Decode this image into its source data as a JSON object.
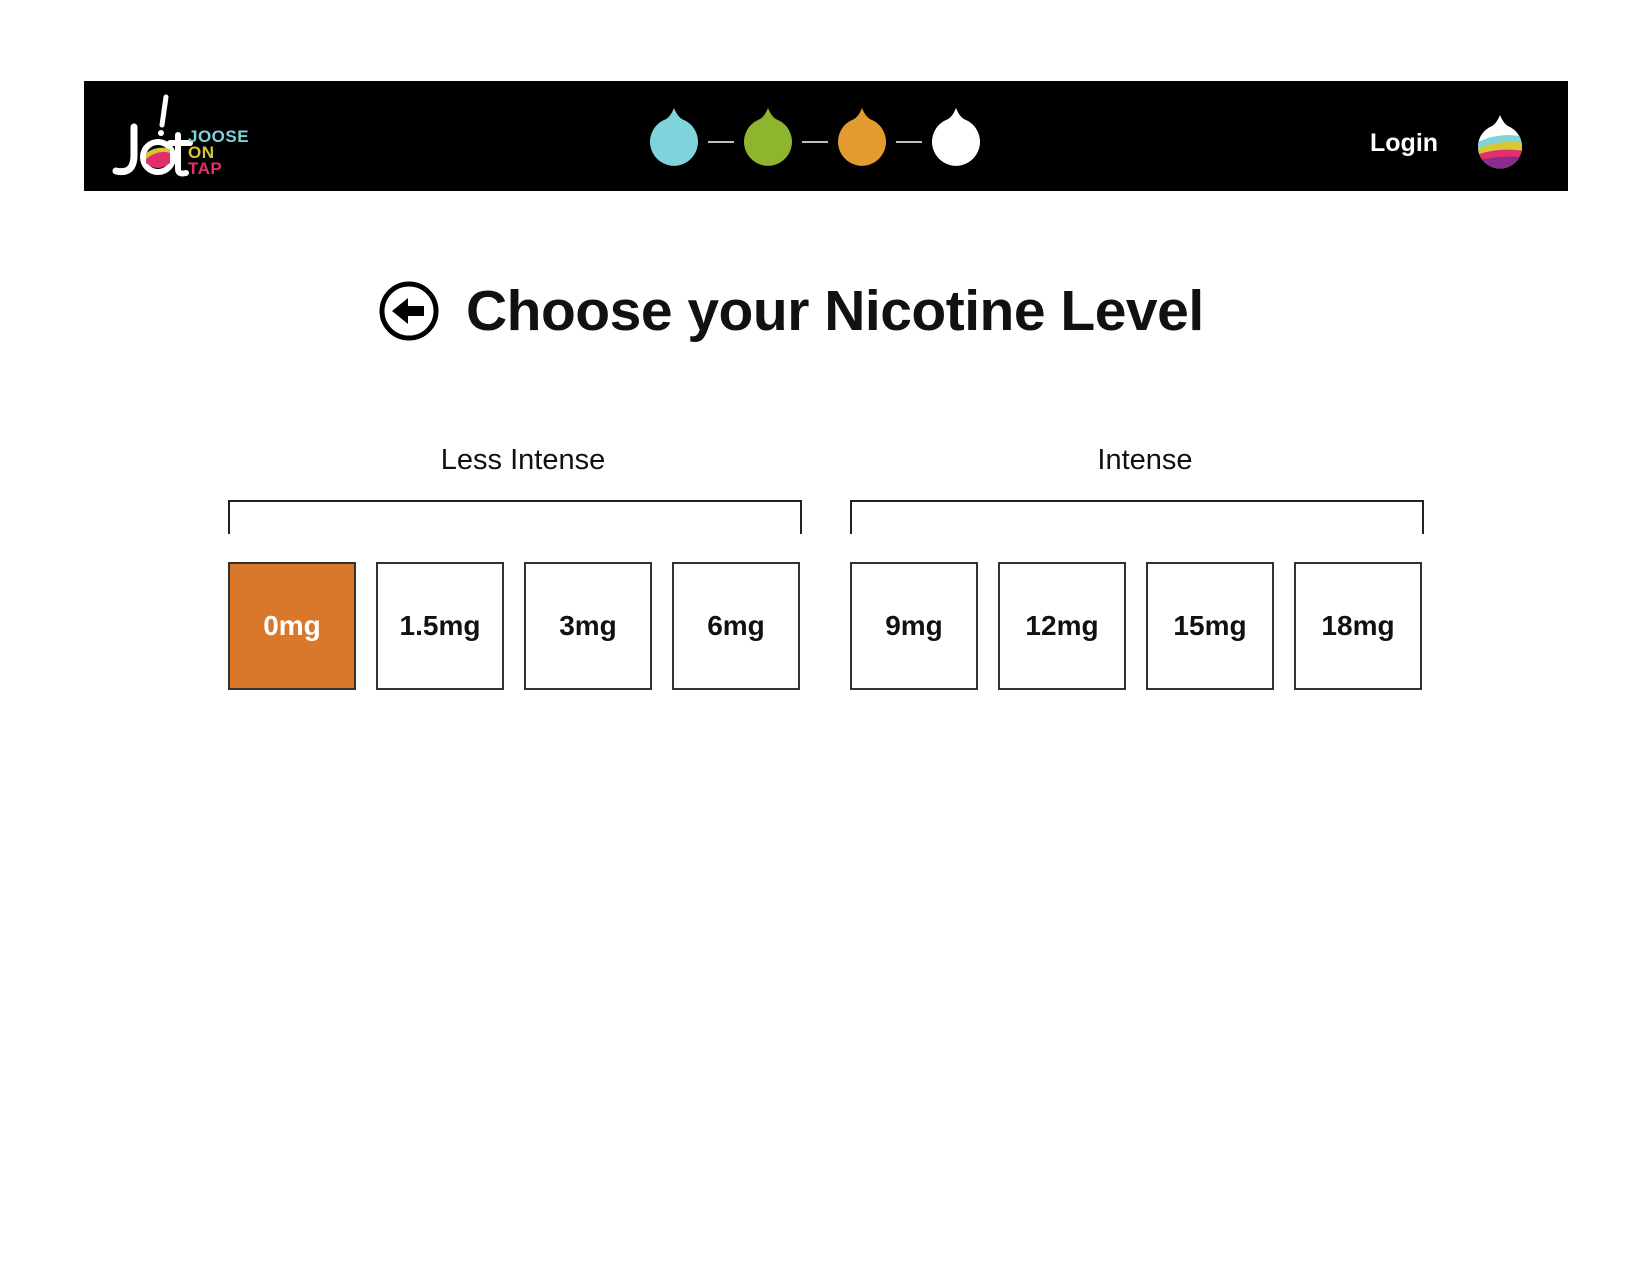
{
  "header": {
    "logo": {
      "mark": "JoT",
      "words": [
        "JOOSE",
        "ON",
        "TAP"
      ]
    },
    "steps": [
      {
        "icon": "drop-icon",
        "color": "#7fd3da"
      },
      {
        "icon": "drop-icon",
        "color": "#8db52e"
      },
      {
        "icon": "drop-icon",
        "color": "#e39a2f"
      },
      {
        "icon": "drop-icon",
        "color": "#ffffff"
      }
    ],
    "login_label": "Login"
  },
  "main": {
    "title": "Choose your Nicotine Level",
    "groups": [
      {
        "label": "Less Intense"
      },
      {
        "label": "Intense"
      }
    ],
    "levels": [
      "0mg",
      "1.5mg",
      "3mg",
      "6mg",
      "9mg",
      "12mg",
      "15mg",
      "18mg"
    ],
    "selected_level": "0mg"
  },
  "colors": {
    "accent": "#d9782a",
    "header_bg": "#000000"
  }
}
